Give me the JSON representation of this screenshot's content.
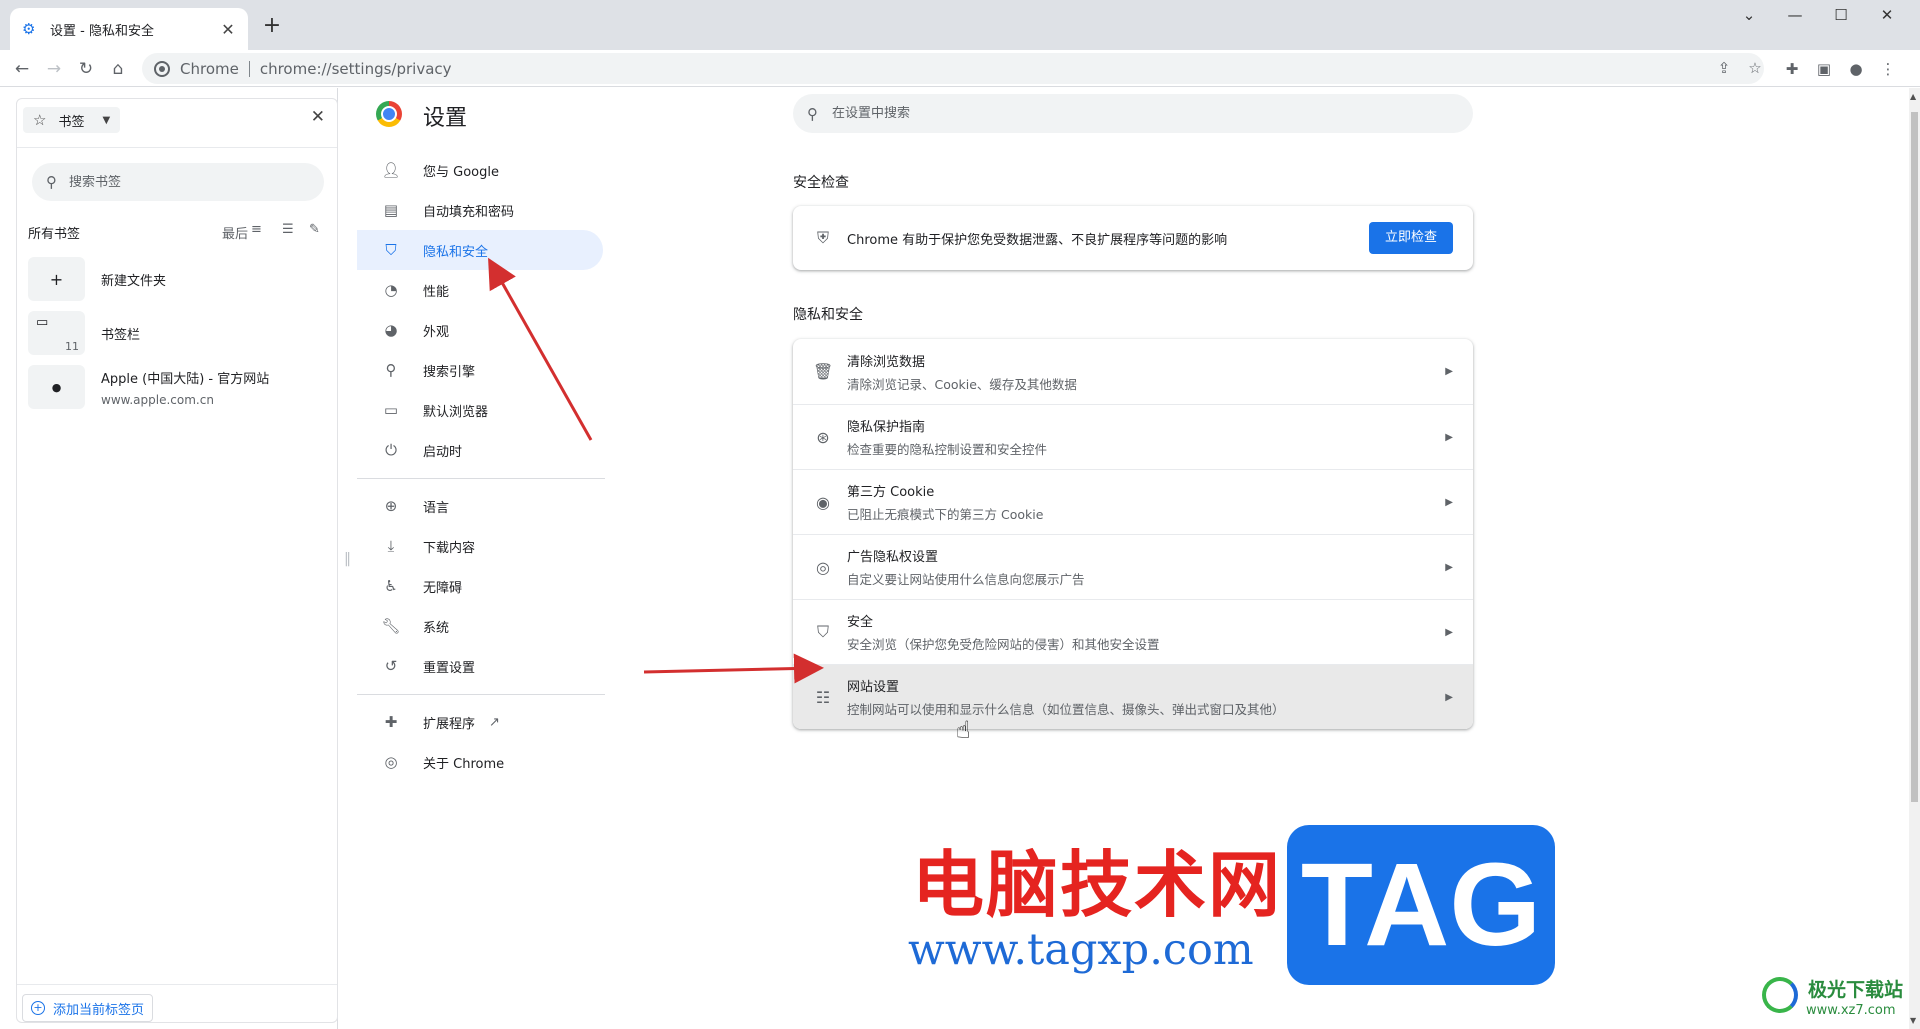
{
  "browser": {
    "tab_title": "设置 - 隐私和安全",
    "omnibox_chip": "Chrome",
    "url": "chrome://settings/privacy"
  },
  "bookmarks_panel": {
    "header_label": "书签",
    "search_placeholder": "搜索书签",
    "all_label": "所有书签",
    "sort_label": "最后",
    "items": [
      {
        "title": "新建文件夹",
        "subtitle": ""
      },
      {
        "title": "书签栏",
        "subtitle": "",
        "count": "11"
      },
      {
        "title": "Apple (中国大陆) - 官方网站",
        "subtitle": "www.apple.com.cn"
      }
    ],
    "add_button": "添加当前标签页"
  },
  "settings": {
    "title": "设置",
    "search_placeholder": "在设置中搜索",
    "nav": [
      {
        "label": "您与 Google",
        "icon": "person-icon"
      },
      {
        "label": "自动填充和密码",
        "icon": "clipboard-icon"
      },
      {
        "label": "隐私和安全",
        "icon": "shield-icon",
        "active": true
      },
      {
        "label": "性能",
        "icon": "speedometer-icon"
      },
      {
        "label": "外观",
        "icon": "palette-icon"
      },
      {
        "label": "搜索引擎",
        "icon": "search-icon"
      },
      {
        "label": "默认浏览器",
        "icon": "browser-icon"
      },
      {
        "label": "启动时",
        "icon": "power-icon"
      },
      {
        "label": "语言",
        "icon": "globe-icon"
      },
      {
        "label": "下载内容",
        "icon": "download-icon"
      },
      {
        "label": "无障碍",
        "icon": "accessibility-icon"
      },
      {
        "label": "系统",
        "icon": "wrench-icon"
      },
      {
        "label": "重置设置",
        "icon": "history-icon"
      },
      {
        "label": "扩展程序",
        "icon": "puzzle-icon"
      },
      {
        "label": "关于 Chrome",
        "icon": "chrome-icon"
      }
    ],
    "safety_check": {
      "section_title": "安全检查",
      "text": "Chrome 有助于保护您免受数据泄露、不良扩展程序等问题的影响",
      "button": "立即检查"
    },
    "privacy": {
      "section_title": "隐私和安全",
      "rows": [
        {
          "title": "清除浏览数据",
          "subtitle": "清除浏览记录、Cookie、缓存及其他数据",
          "icon": "trash-icon"
        },
        {
          "title": "隐私保护指南",
          "subtitle": "检查重要的隐私控制设置和安全控件",
          "icon": "compass-icon"
        },
        {
          "title": "第三方 Cookie",
          "subtitle": "已阻止无痕模式下的第三方 Cookie",
          "icon": "cookie-icon"
        },
        {
          "title": "广告隐私权设置",
          "subtitle": "自定义要让网站使用什么信息向您展示广告",
          "icon": "ad-privacy-icon"
        },
        {
          "title": "安全",
          "subtitle": "安全浏览（保护您免受危险网站的侵害）和其他安全设置",
          "icon": "shield-icon"
        },
        {
          "title": "网站设置",
          "subtitle": "控制网站可以使用和显示什么信息（如位置信息、摄像头、弹出式窗口及其他）",
          "icon": "sliders-icon"
        }
      ]
    }
  },
  "watermark": {
    "cn_text": "电脑技术网",
    "url": "www.tagxp.com",
    "tag": "TAG",
    "brand": "极光下载站",
    "brand_url": "www.xz7.com"
  },
  "colors": {
    "accent": "#1a73e8",
    "active_nav_bg": "#e8f0fe",
    "annotation_arrow": "#d32f2f",
    "watermark_red": "#e52420"
  }
}
